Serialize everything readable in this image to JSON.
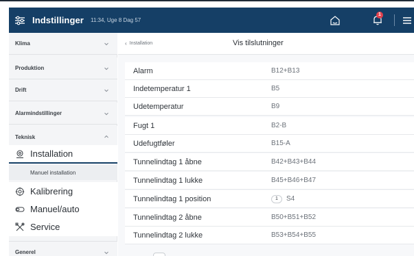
{
  "header": {
    "title": "Indstillinger",
    "meta": "11:34, Uge 8 Dag 57",
    "notification_count": "1",
    "colors": {
      "bar": "#153f66",
      "badge": "#e2424e"
    }
  },
  "sidebar": {
    "sections": [
      {
        "label": "Klima",
        "expanded": false
      },
      {
        "label": "Produktion",
        "expanded": false
      },
      {
        "label": "Drift",
        "expanded": false
      },
      {
        "label": "Alarmindstillinger",
        "expanded": false
      },
      {
        "label": "Teknisk",
        "expanded": true
      },
      {
        "label": "Generel",
        "expanded": false
      }
    ],
    "items": [
      {
        "label": "Installation",
        "icon": "installation-icon",
        "active": true
      },
      {
        "label": "Manuel installation",
        "sub": true
      },
      {
        "label": "Kalibrering",
        "icon": "calibration-icon"
      },
      {
        "label": "Manuel/auto",
        "icon": "toggle-icon"
      },
      {
        "label": "Service",
        "icon": "tools-icon"
      }
    ]
  },
  "main": {
    "breadcrumb": "Installation",
    "title": "Vis tilslutninger",
    "rows": [
      {
        "name": "Alarm",
        "value": "B12+B13"
      },
      {
        "name": "Indetemperatur 1",
        "value": "B5"
      },
      {
        "name": "Udetemperatur",
        "value": "B9"
      },
      {
        "name": "Fugt 1",
        "value": "B2-B"
      },
      {
        "name": "Udefugtføler",
        "value": "B15-A"
      },
      {
        "name": "Tunnelindtag 1 åbne",
        "value": "B42+B43+B44"
      },
      {
        "name": "Tunnelindtag 1 lukke",
        "value": "B45+B46+B47"
      },
      {
        "name": "Tunnelindtag 1 position",
        "chip": "1",
        "value": "S4"
      },
      {
        "name": "Tunnelindtag 2 åbne",
        "value": "B50+B51+B52"
      },
      {
        "name": "Tunnelindtag 2 lukke",
        "value": "B53+B54+B55"
      }
    ]
  }
}
